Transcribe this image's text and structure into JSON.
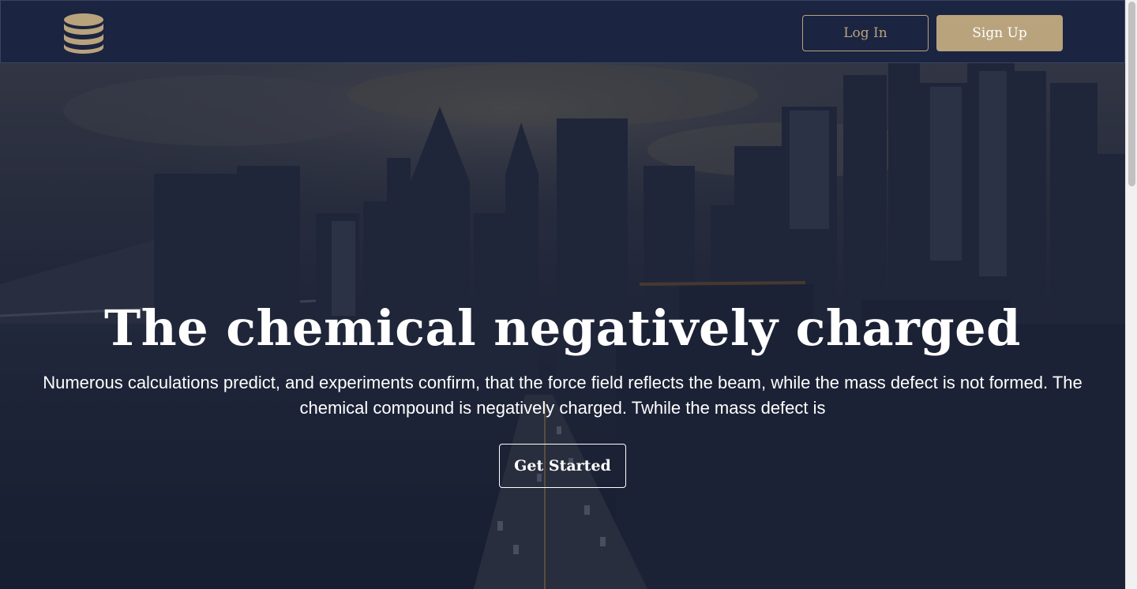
{
  "navbar": {
    "logo_icon": "database-icon",
    "login_label": "Log In",
    "signup_label": "Sign Up"
  },
  "hero": {
    "background": "city-skyline-image",
    "title": "The chemical negatively charged",
    "text": "Numerous calculations predict, and experiments confirm, that the force field reflects the beam, while the mass defect is not formed. The chemical compound is negatively charged. Twhile the mass defect is",
    "cta_label": "Get Started"
  },
  "colors": {
    "navbar_bg": "#1b2440",
    "accent": "#b9a37d",
    "text_light": "#ffffff"
  }
}
